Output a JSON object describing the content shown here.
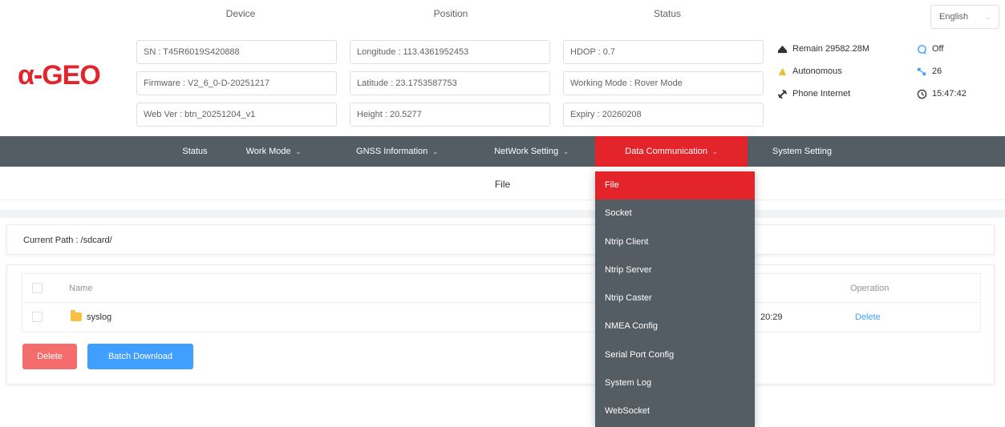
{
  "logo": "α-GEO",
  "columns": {
    "device": "Device",
    "position": "Position",
    "status": "Status"
  },
  "device": {
    "sn": "SN : T45R6019S420888",
    "firmware": "Firmware : V2_6_0-D-20251217",
    "web_ver": "Web Ver : btn_20251204_v1"
  },
  "position": {
    "longitude": "Longitude : 113.4361952453",
    "latitude": "Latitude : 23.1753587753",
    "height": "Height : 20.5277"
  },
  "status": {
    "hdop": "HDOP : 0.7",
    "working_mode": "Working Mode : Rover Mode",
    "expiry": "Expiry : 20260208"
  },
  "indicators": {
    "remain": "Remain 29582.28M",
    "solution": "Autonomous",
    "network": "Phone Internet",
    "signal": "Off",
    "satellites": "26",
    "time": "15:47:42"
  },
  "language": "English",
  "nav": {
    "items": [
      {
        "label": "Status",
        "has_caret": false
      },
      {
        "label": "Work Mode",
        "has_caret": true
      },
      {
        "label": "GNSS Information",
        "has_caret": true
      },
      {
        "label": "NetWork Setting",
        "has_caret": true
      },
      {
        "label": "Data Communication",
        "has_caret": true
      },
      {
        "label": "System Setting",
        "has_caret": false
      }
    ],
    "active_index": 4
  },
  "dropdown": {
    "items": [
      "File",
      "Socket",
      "Ntrip Client",
      "Ntrip Server",
      "Ntrip Caster",
      "NMEA Config",
      "Serial Port Config",
      "System Log",
      "WebSocket"
    ],
    "active_index": 0
  },
  "page_title": "File",
  "current_path": "Current Path : /sdcard/",
  "table": {
    "headers": {
      "name": "Name",
      "operation": "Operation"
    },
    "rows": [
      {
        "name": "syslog",
        "time": "20:29",
        "operation": "Delete"
      }
    ]
  },
  "buttons": {
    "delete": "Delete",
    "batch_download": "Batch Download"
  },
  "colors": {
    "accent": "#e3242b",
    "nav_bg": "#545c64",
    "primary": "#409eff",
    "danger": "#f56c6c"
  }
}
